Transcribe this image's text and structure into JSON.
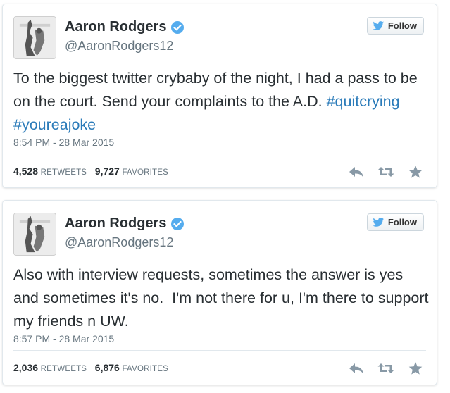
{
  "colors": {
    "hashtag": "#2b7bb9",
    "verified": "#55acee",
    "twitter_bird": "#55acee",
    "muted_text": "#66757f",
    "action_icon": "#8899a6"
  },
  "icons": {
    "verified": "verified-badge-icon",
    "follow": "twitter-bird-icon",
    "reply": "reply-icon",
    "retweet": "retweet-icon",
    "favorite": "star-icon"
  },
  "tweets": [
    {
      "author": {
        "name": "Aaron Rodgers",
        "handle": "@AaronRodgers12",
        "verified": true
      },
      "follow_label": "Follow",
      "text_main": "To the biggest twitter crybaby of the night, I had a pass to be on the court. Send your complaints to the A.D. ",
      "hashtags": [
        "#quitcrying",
        "#youreajoke"
      ],
      "timestamp": "8:54 PM - 28 Mar 2015",
      "retweets_count": "4,528",
      "retweets_label": "RETWEETS",
      "favorites_count": "9,727",
      "favorites_label": "FAVORITES"
    },
    {
      "author": {
        "name": "Aaron Rodgers",
        "handle": "@AaronRodgers12",
        "verified": true
      },
      "follow_label": "Follow",
      "text_main": "Also with interview requests, sometimes the answer is yes and sometimes it's no.  I'm not there for u, I'm there to support my friends n UW.",
      "hashtags": [],
      "timestamp": "8:57 PM - 28 Mar 2015",
      "retweets_count": "2,036",
      "retweets_label": "RETWEETS",
      "favorites_count": "6,876",
      "favorites_label": "FAVORITES"
    }
  ]
}
